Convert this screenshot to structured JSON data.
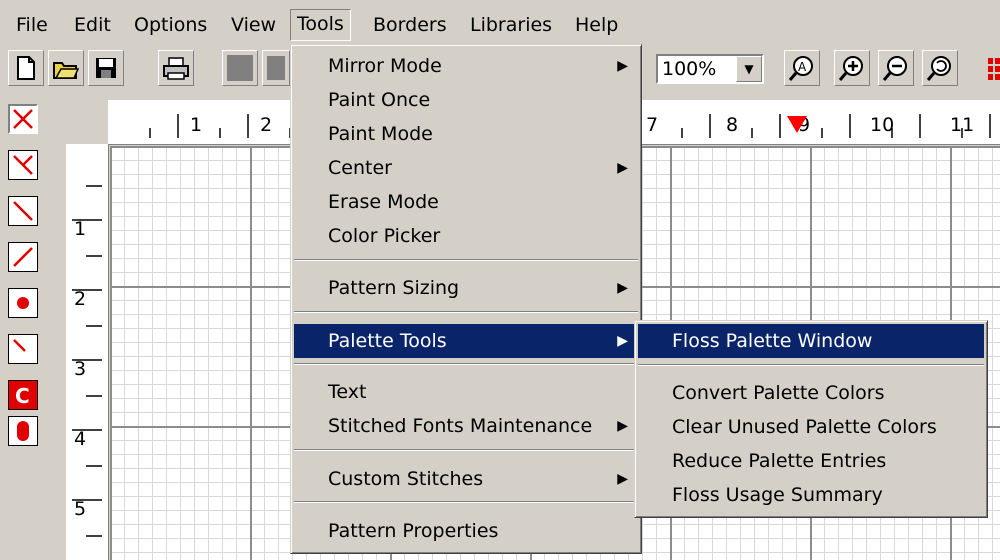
{
  "menubar": {
    "items": [
      "File",
      "Edit",
      "Options",
      "View",
      "Tools",
      "Borders",
      "Libraries",
      "Help"
    ]
  },
  "toolbar": {
    "zoom_value": "100%",
    "icons": [
      "new-document-icon",
      "open-folder-icon",
      "save-disk-icon",
      "print-icon",
      "color-swatch-icon",
      "zoom-fit-icon",
      "zoom-in-icon",
      "zoom-out-icon",
      "zoom-reset-icon"
    ]
  },
  "ruler": {
    "horizontal_labels": [
      "1",
      "2",
      "7",
      "8",
      "9",
      "10",
      "11"
    ],
    "vertical_labels": [
      "1",
      "2",
      "3",
      "4",
      "5"
    ]
  },
  "tools_menu": {
    "items": [
      {
        "label": "Mirror Mode",
        "submenu": true
      },
      {
        "label": "Paint Once",
        "submenu": false
      },
      {
        "label": "Paint Mode",
        "submenu": false
      },
      {
        "label": "Center",
        "submenu": true
      },
      {
        "label": "Erase Mode",
        "submenu": false
      },
      {
        "label": "Color Picker",
        "submenu": false
      },
      {
        "label": "Pattern Sizing",
        "submenu": true
      },
      {
        "label": "Palette Tools",
        "submenu": true
      },
      {
        "label": "Text",
        "submenu": false
      },
      {
        "label": "Stitched Fonts Maintenance",
        "submenu": true
      },
      {
        "label": "Custom Stitches",
        "submenu": true
      },
      {
        "label": "Pattern Properties",
        "submenu": false
      }
    ]
  },
  "palette_submenu": {
    "items": [
      "Floss Palette Window",
      "Convert Palette Colors",
      "Clear Unused Palette Colors",
      "Reduce Palette Entries",
      "Floss Usage Summary"
    ]
  },
  "colors": {
    "highlight": "#0a246a",
    "chrome": "#d4d0c8",
    "stitch_red": "#e00000",
    "marker_red": "#ff0000"
  }
}
